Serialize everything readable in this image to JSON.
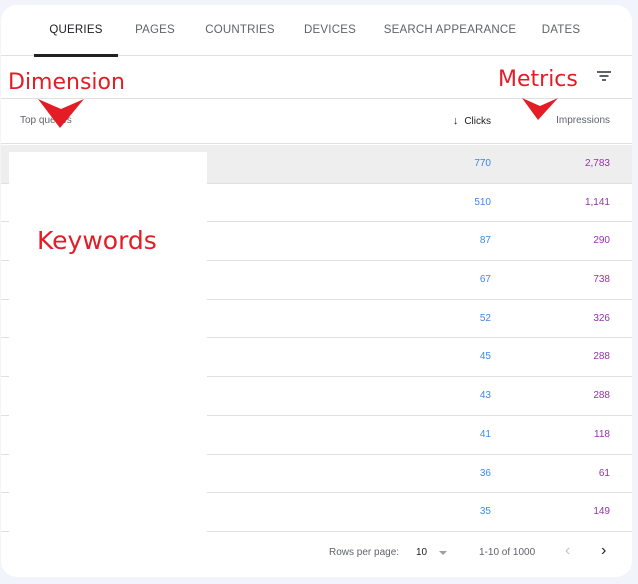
{
  "tabs": [
    {
      "label": "QUERIES",
      "active": true
    },
    {
      "label": "PAGES",
      "active": false
    },
    {
      "label": "COUNTRIES",
      "active": false
    },
    {
      "label": "DEVICES",
      "active": false
    },
    {
      "label": "SEARCH APPEARANCE",
      "active": false
    },
    {
      "label": "DATES",
      "active": false
    }
  ],
  "toolbar": {
    "filter_icon": "filter-list-icon"
  },
  "table": {
    "columns": {
      "dimension": "Top queries",
      "clicks": "Clicks",
      "clicks_sort_icon": "↓",
      "impressions": "Impressions"
    },
    "rows": [
      {
        "query": "",
        "clicks": "770",
        "impressions": "2,783"
      },
      {
        "query": "",
        "clicks": "510",
        "impressions": "1,141"
      },
      {
        "query": "",
        "clicks": "87",
        "impressions": "290"
      },
      {
        "query": "",
        "clicks": "67",
        "impressions": "738"
      },
      {
        "query": "",
        "clicks": "52",
        "impressions": "326"
      },
      {
        "query": "",
        "clicks": "45",
        "impressions": "288"
      },
      {
        "query": "",
        "clicks": "43",
        "impressions": "288"
      },
      {
        "query": "",
        "clicks": "41",
        "impressions": "118"
      },
      {
        "query": "",
        "clicks": "36",
        "impressions": "61"
      },
      {
        "query": "",
        "clicks": "35",
        "impressions": "149"
      }
    ]
  },
  "pagination": {
    "rows_per_page_label": "Rows per page:",
    "rows_per_page_value": "10",
    "range": "1-10 of 1000",
    "prev": "‹",
    "next": "›"
  },
  "annotations": {
    "dimension": "Dimension",
    "metrics": "Metrics",
    "keywords": "Keywords",
    "color": "#e31c25"
  },
  "colors": {
    "clicks": "#1a73e8",
    "impressions": "#9334a8",
    "background": "#f1f4fb"
  }
}
